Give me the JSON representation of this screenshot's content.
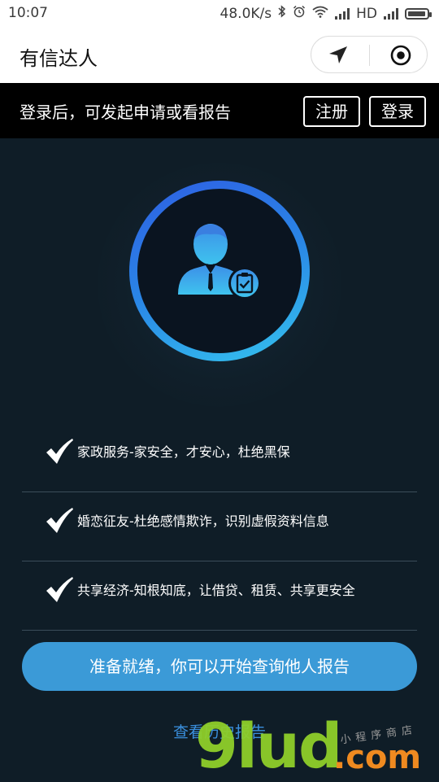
{
  "status_bar": {
    "time": "10:07",
    "network_speed": "48.0K/s",
    "network_type": "HD",
    "icons": [
      "bluetooth-icon",
      "alarm-icon",
      "wifi-icon",
      "signal-icon",
      "battery-icon"
    ]
  },
  "nav": {
    "title": "有信达人",
    "capsule_icons": [
      "location-arrow-icon",
      "record-icon"
    ]
  },
  "login_banner": {
    "text": "登录后，可发起申请或看报告",
    "register_label": "注册",
    "login_label": "登录"
  },
  "hero": {
    "icon": "user-report-icon",
    "colors": {
      "ring_start": "#2e5fe3",
      "ring_end": "#35c4ee"
    }
  },
  "features": [
    {
      "icon": "check-icon",
      "text": "家政服务-家安全，才安心，杜绝黑保"
    },
    {
      "icon": "check-icon",
      "text": "婚恋征友-杜绝感情欺诈，识别虚假资料信息"
    },
    {
      "icon": "check-icon",
      "text": "共享经济-知根知底，让借贷、租赁、共享更安全"
    }
  ],
  "primary_button": {
    "label": "准备就绪，你可以开始查询他人报告",
    "color": "#3b9ad7"
  },
  "history_link": {
    "label": "查看历史报告",
    "color": "#3a8fdd"
  },
  "watermark": {
    "main": "9lud",
    "domain": ".com",
    "sub": "小程序商店"
  },
  "colors": {
    "background": "#0f1d27",
    "banner": "#000000",
    "accent": "#3b9ad7"
  }
}
